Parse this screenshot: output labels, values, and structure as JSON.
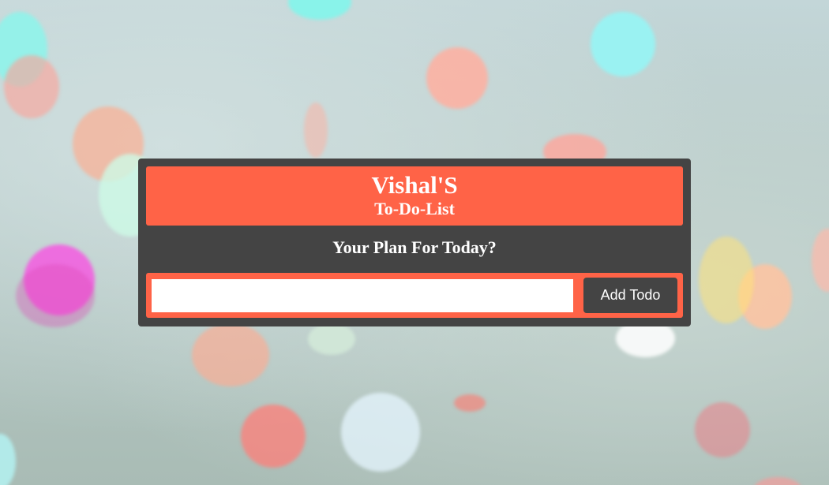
{
  "app": {
    "owner_title": "Vishal'S",
    "app_title": "To-Do-List"
  },
  "prompt": {
    "text": "Your Plan For Today?"
  },
  "todo_form": {
    "input_value": "",
    "placeholder": "",
    "add_button_label": "Add Todo"
  },
  "colors": {
    "accent": "#ff6347",
    "card_background": "#444444",
    "text": "#ffffff"
  }
}
